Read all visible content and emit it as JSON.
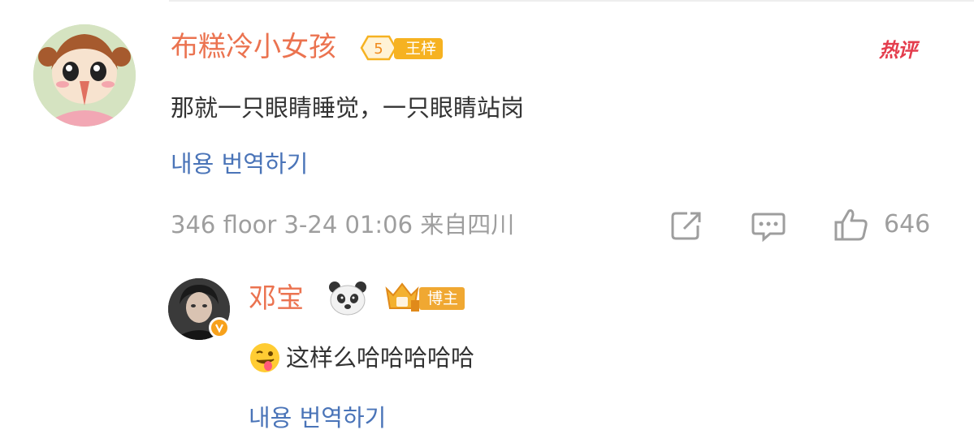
{
  "comment": {
    "username": "布糕冷小女孩",
    "level": "5",
    "title_badge": "王梓",
    "hot_label": "热评",
    "text": "那就一只眼睛睡觉，一只眼睛站岗",
    "translate": "내용 번역하기",
    "meta": "346 floor 3-24 01:06 来自四川",
    "like_count": "646"
  },
  "reply": {
    "username": "邓宝",
    "emoji": "panda",
    "role_badge": "博主",
    "text": "这样么哈哈哈哈哈",
    "leading_emoji": "winking-face-with-tongue",
    "translate": "내용 번역하기"
  },
  "colors": {
    "username": "#eb7350",
    "link": "#4a74b8",
    "meta": "#9e9e9e",
    "hot": "#e43d4d",
    "badge": "#f6b221"
  },
  "icons": [
    "share-icon",
    "comment-icon",
    "thumbs-up-icon",
    "verified-icon"
  ]
}
